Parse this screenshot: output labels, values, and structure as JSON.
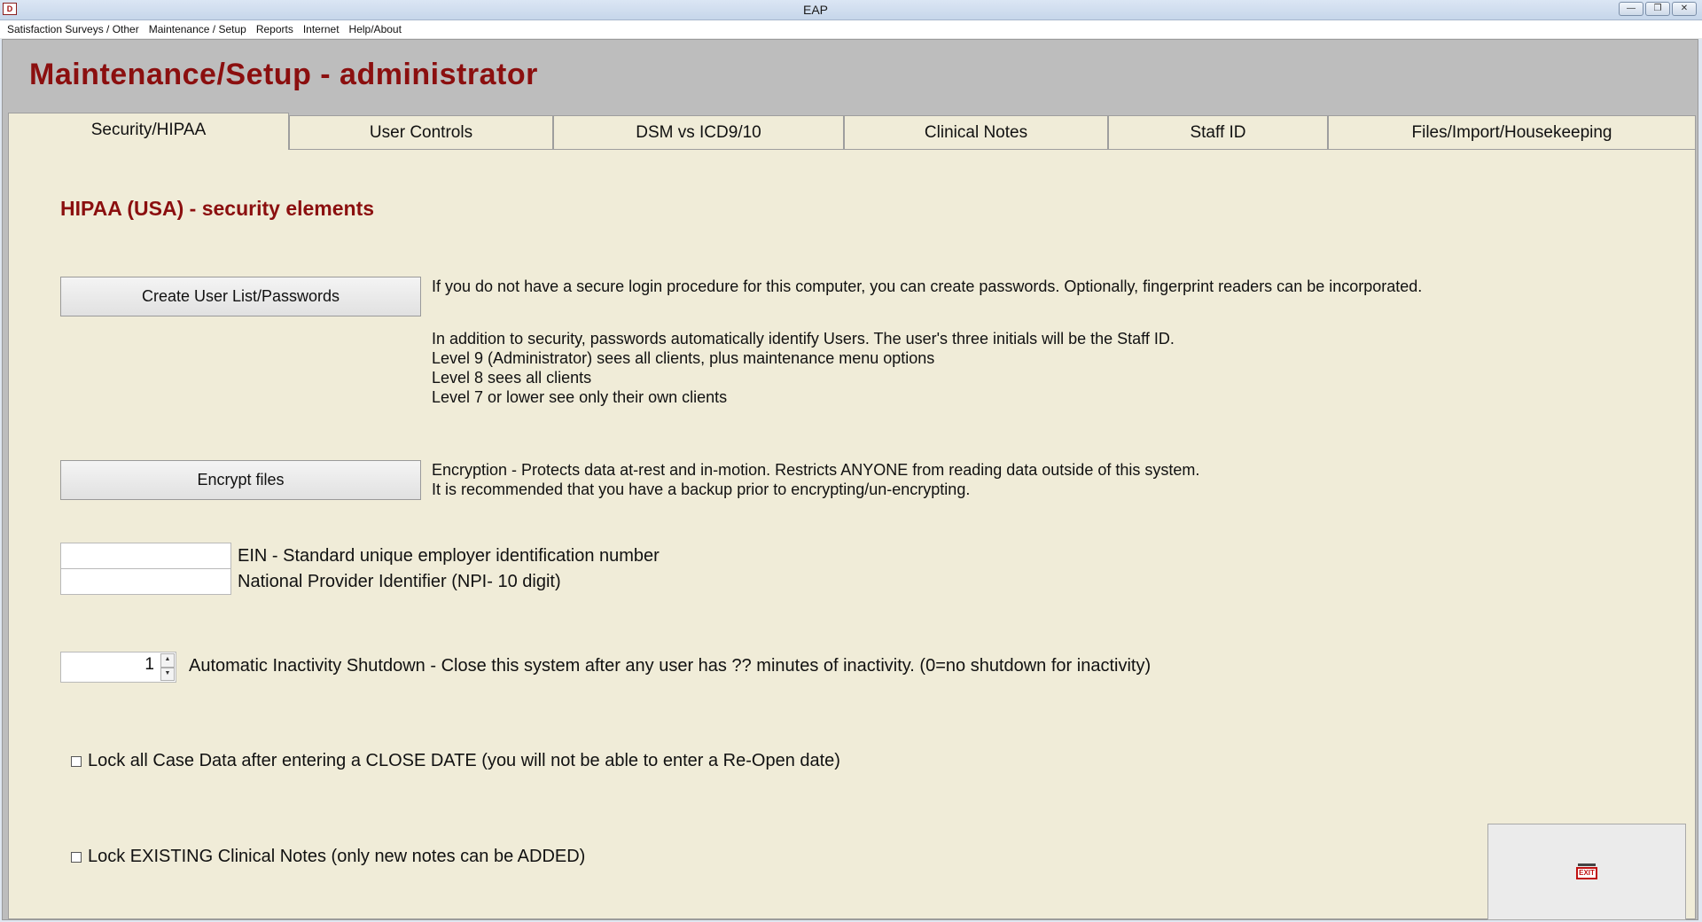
{
  "window": {
    "title": "EAP",
    "app_icon_text": "D",
    "controls": {
      "minimize": "—",
      "restore": "❐",
      "close": "✕"
    }
  },
  "menu": {
    "items": [
      "Satisfaction Surveys / Other",
      "Maintenance / Setup",
      "Reports",
      "Internet",
      "Help/About"
    ]
  },
  "page": {
    "title": "Maintenance/Setup - administrator"
  },
  "tabs": [
    {
      "label": "Security/HIPAA",
      "active": true
    },
    {
      "label": "User Controls",
      "active": false
    },
    {
      "label": "DSM vs ICD9/10",
      "active": false
    },
    {
      "label": "Clinical Notes",
      "active": false
    },
    {
      "label": "Staff ID",
      "active": false
    },
    {
      "label": "Files/Import/Housekeeping",
      "active": false
    }
  ],
  "security": {
    "heading": "HIPAA (USA) - security elements",
    "create_users_button": "Create User List/Passwords",
    "create_users_desc": "If you do not have a secure login procedure for this computer, you can create passwords.  Optionally, fingerprint readers can be incorporated.",
    "levels_text": [
      "In addition to security, passwords automatically identify Users.  The user's three initials will be the Staff ID.",
      "Level 9 (Administrator) sees all clients, plus maintenance menu options",
      "Level 8 sees all clients",
      "Level 7 or lower see only their own clients"
    ],
    "encrypt_button": "Encrypt files",
    "encrypt_desc": [
      "Encryption - Protects data at-rest and in-motion.  Restricts ANYONE from reading data outside of this system.",
      "It is recommended that you have a backup prior to encrypting/un-encrypting."
    ],
    "ein_label": "EIN - Standard unique employer identification number",
    "ein_value": "",
    "npi_label": "National Provider Identifier (NPI- 10 digit)",
    "npi_value": "",
    "inactivity_value": "1",
    "inactivity_label": "Automatic Inactivity Shutdown - Close this system after any user has ?? minutes of inactivity.  (0=no shutdown for inactivity)",
    "lock_case_label": "Lock all Case Data after entering a CLOSE DATE (you will not be able to enter a Re-Open date)",
    "lock_case_checked": false,
    "lock_notes_label": "Lock EXISTING Clinical Notes (only new notes can be ADDED)",
    "lock_notes_checked": false,
    "exit_icon_text": "EXIT"
  },
  "icons": {
    "spin_up": "spin-up-arrow-icon",
    "spin_down": "spin-down-arrow-icon",
    "exit": "exit-sign-icon"
  }
}
